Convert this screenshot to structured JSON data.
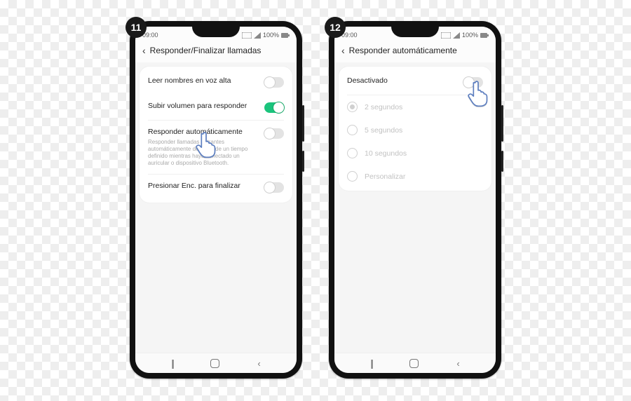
{
  "steps": {
    "left": "11",
    "right": "12"
  },
  "status": {
    "time": "09:00",
    "battery": "100%"
  },
  "screen_left": {
    "title": "Responder/Finalizar llamadas",
    "rows": {
      "read_names": {
        "label": "Leer nombres en voz alta",
        "on": false
      },
      "volume_up": {
        "label": "Subir volumen para responder",
        "on": true
      },
      "auto_answer": {
        "label": "Responder automáticamente",
        "sub": "Responder llamadas entrantes automáticamente después de un tiempo definido mientras haya conectado un auricular o dispositivo Bluetooth.",
        "on": false
      },
      "power_end": {
        "label": "Presionar Enc. para finalizar",
        "on": false
      }
    }
  },
  "screen_right": {
    "title": "Responder automáticamente",
    "toggle": {
      "label": "Desactivado",
      "on": false
    },
    "options": {
      "o1": {
        "label": "2 segundos",
        "selected": true
      },
      "o2": {
        "label": "5 segundos",
        "selected": false
      },
      "o3": {
        "label": "10 segundos",
        "selected": false
      },
      "o4": {
        "label": "Personalizar",
        "selected": false
      }
    }
  }
}
